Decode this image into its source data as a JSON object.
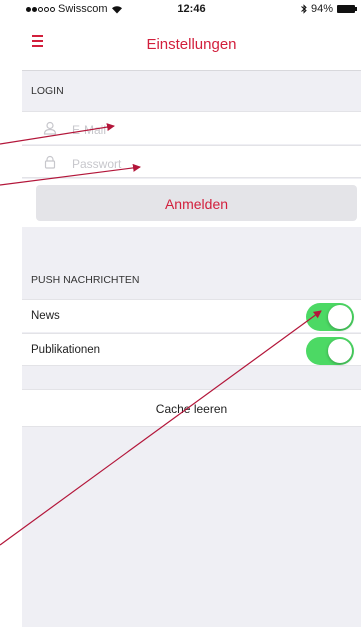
{
  "status_bar": {
    "carrier": "Swisscom",
    "time": "12:46",
    "battery": "94%"
  },
  "header": {
    "title": "Einstellungen"
  },
  "login": {
    "section_title": "LOGIN",
    "email_placeholder": "E-Mail",
    "password_placeholder": "Passwort",
    "submit_label": "Anmelden"
  },
  "push": {
    "section_title": "PUSH NACHRICHTEN",
    "items": [
      {
        "label": "News",
        "enabled": true
      },
      {
        "label": "Publikationen",
        "enabled": true
      }
    ]
  },
  "cache": {
    "clear_label": "Cache leeren"
  },
  "colors": {
    "accent": "#d21f3c",
    "toggle_on": "#4cd964",
    "background": "#efeff4",
    "annotation_arrow": "#b3163a"
  }
}
